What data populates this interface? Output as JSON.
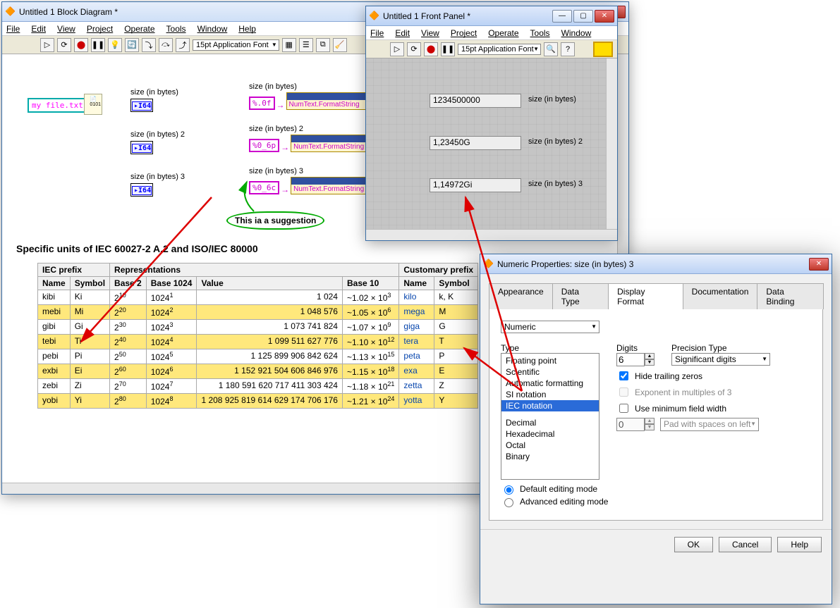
{
  "bd": {
    "title": "Untitled 1 Block Diagram *",
    "menus": [
      "File",
      "Edit",
      "View",
      "Project",
      "Operate",
      "Tools",
      "Window",
      "Help"
    ],
    "font": "15pt Application Font",
    "file_const": "my file.txt",
    "labels": {
      "s1": "size (in bytes)",
      "s2": "size (in bytes) 2",
      "s3": "size (in bytes) 3",
      "p1": "size (in bytes)",
      "p2": "size (in bytes) 2",
      "p3": "size (in bytes) 3"
    },
    "i64": "I64",
    "fmt": {
      "f1": "%.0f",
      "f2": "%0_6p",
      "f3": "%0_6c"
    },
    "prop_line": "NumText.FormatString",
    "suggestion": "This ia a suggestion"
  },
  "fp": {
    "title": "Untitled 1 Front Panel *",
    "menus": [
      "File",
      "Edit",
      "View",
      "Project",
      "Operate",
      "Tools",
      "Window"
    ],
    "font": "15pt Application Font",
    "ind": [
      {
        "val": "1234500000",
        "lbl": "size (in bytes)"
      },
      {
        "val": "1,23450G",
        "lbl": "size (in bytes) 2"
      },
      {
        "val": "1,14972Gi",
        "lbl": "size (in bytes) 3"
      }
    ]
  },
  "iec": {
    "title": "Specific units of IEC 60027-2 A.2 and ISO/IEC 80000",
    "headers": {
      "top": [
        "IEC prefix",
        "Representations",
        "Customary prefix"
      ],
      "sub": [
        "Name",
        "Symbol",
        "Base 2",
        "Base 1024",
        "Value",
        "Base 10",
        "Name",
        "Symbol"
      ]
    },
    "rows": [
      {
        "y": 0,
        "n": "kibi",
        "s": "Ki",
        "b2": "2",
        "e2": "10",
        "b1024": "1024",
        "e1024": "1",
        "val": "1 024",
        "b10": "~1.02 × 10",
        "e10": "3",
        "cn": "kilo",
        "cs": "k, K"
      },
      {
        "y": 1,
        "n": "mebi",
        "s": "Mi",
        "b2": "2",
        "e2": "20",
        "b1024": "1024",
        "e1024": "2",
        "val": "1 048 576",
        "b10": "~1.05 × 10",
        "e10": "6",
        "cn": "mega",
        "cs": "M"
      },
      {
        "y": 0,
        "n": "gibi",
        "s": "Gi",
        "b2": "2",
        "e2": "30",
        "b1024": "1024",
        "e1024": "3",
        "val": "1 073 741 824",
        "b10": "~1.07 × 10",
        "e10": "9",
        "cn": "giga",
        "cs": "G"
      },
      {
        "y": 1,
        "n": "tebi",
        "s": "Ti",
        "b2": "2",
        "e2": "40",
        "b1024": "1024",
        "e1024": "4",
        "val": "1 099 511 627 776",
        "b10": "~1.10 × 10",
        "e10": "12",
        "cn": "tera",
        "cs": "T"
      },
      {
        "y": 0,
        "n": "pebi",
        "s": "Pi",
        "b2": "2",
        "e2": "50",
        "b1024": "1024",
        "e1024": "5",
        "val": "1 125 899 906 842 624",
        "b10": "~1.13 × 10",
        "e10": "15",
        "cn": "peta",
        "cs": "P"
      },
      {
        "y": 1,
        "n": "exbi",
        "s": "Ei",
        "b2": "2",
        "e2": "60",
        "b1024": "1024",
        "e1024": "6",
        "val": "1 152 921 504 606 846 976",
        "b10": "~1.15 × 10",
        "e10": "18",
        "cn": "exa",
        "cs": "E"
      },
      {
        "y": 0,
        "n": "zebi",
        "s": "Zi",
        "b2": "2",
        "e2": "70",
        "b1024": "1024",
        "e1024": "7",
        "val": "1 180 591 620 717 411 303 424",
        "b10": "~1.18 × 10",
        "e10": "21",
        "cn": "zetta",
        "cs": "Z"
      },
      {
        "y": 1,
        "n": "yobi",
        "s": "Yi",
        "b2": "2",
        "e2": "80",
        "b1024": "1024",
        "e1024": "8",
        "val": "1 208 925 819 614 629 174 706 176",
        "b10": "~1.21 × 10",
        "e10": "24",
        "cn": "yotta",
        "cs": "Y"
      }
    ]
  },
  "props": {
    "title": "Numeric Properties: size (in bytes) 3",
    "tabs": [
      "Appearance",
      "Data Type",
      "Display Format",
      "Documentation",
      "Data Binding"
    ],
    "category": "Numeric",
    "type_label": "Type",
    "types": [
      "Floating point",
      "Scientific",
      "Automatic formatting",
      "SI notation",
      "IEC notation"
    ],
    "types_selected": "IEC notation",
    "types2": [
      "Decimal",
      "Hexadecimal",
      "Octal",
      "Binary"
    ],
    "digits_label": "Digits",
    "digits": "6",
    "precision_label": "Precision Type",
    "precision": "Significant digits",
    "chk_hide": "Hide trailing zeros",
    "chk_exp": "Exponent in multiples of 3",
    "chk_min": "Use minimum field width",
    "min_width": "0",
    "pad_dd": "Pad with spaces on left",
    "radio_default": "Default editing mode",
    "radio_adv": "Advanced editing mode",
    "btns": {
      "ok": "OK",
      "cancel": "Cancel",
      "help": "Help"
    }
  }
}
